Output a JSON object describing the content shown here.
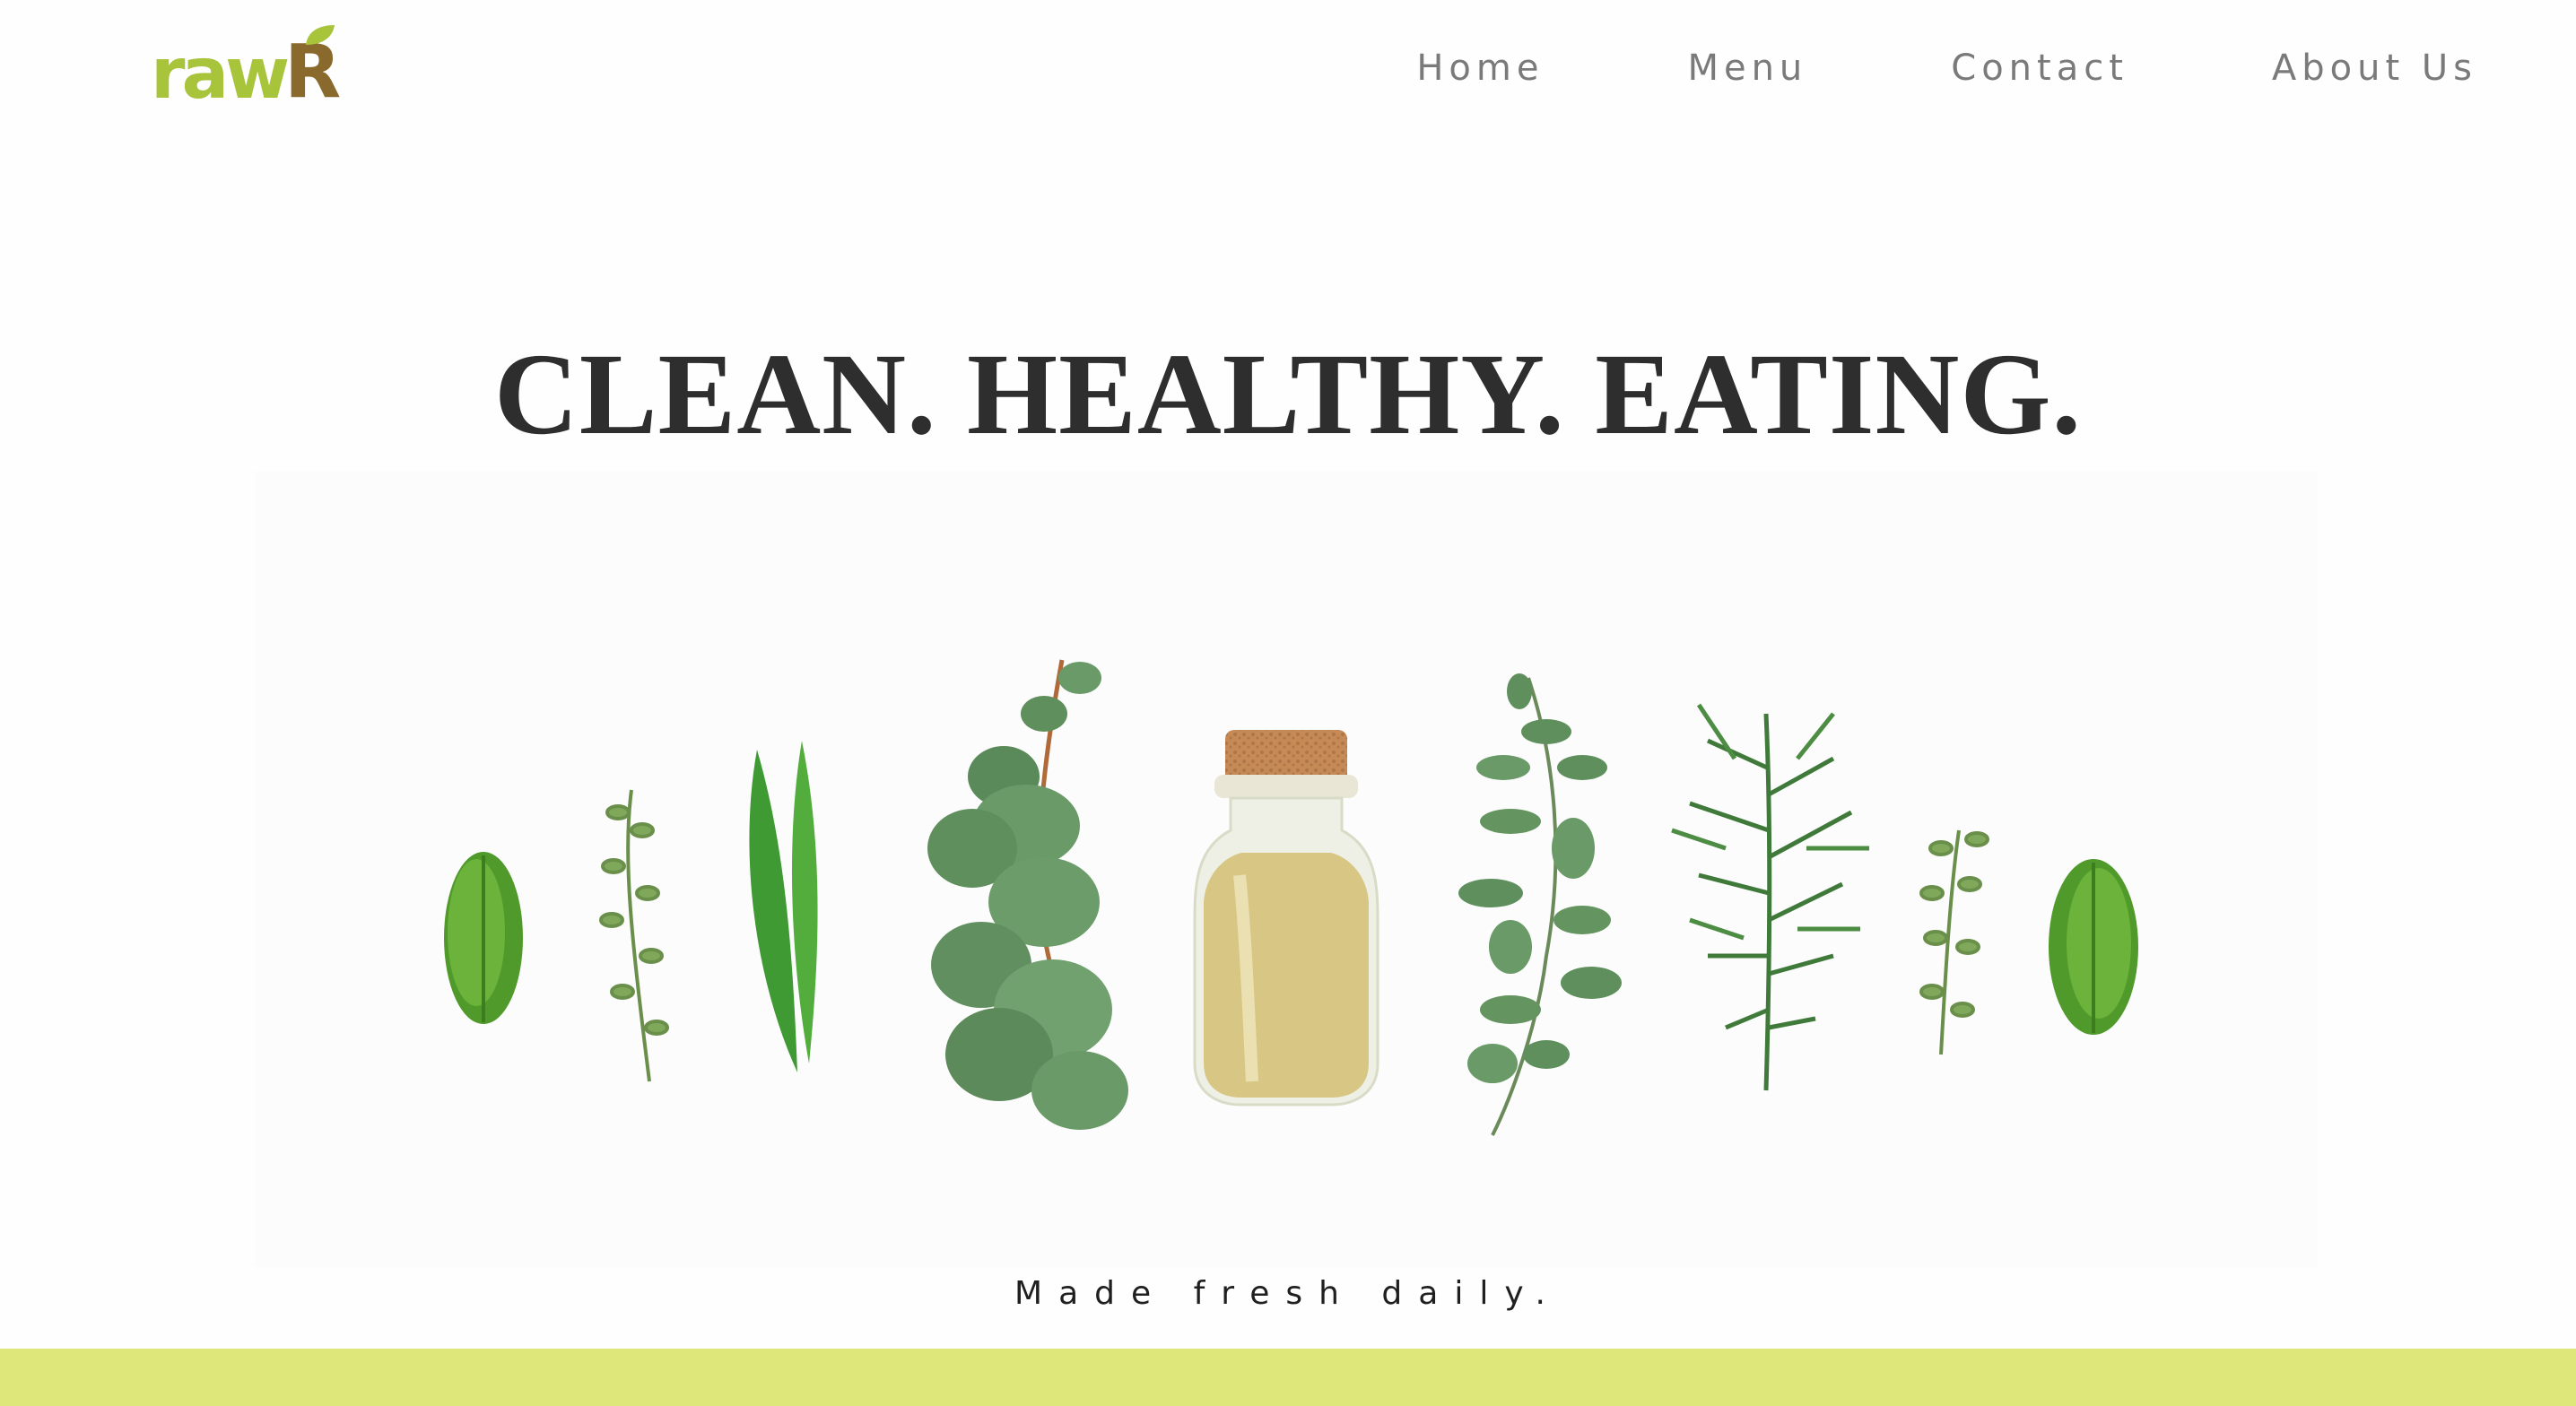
{
  "brand": {
    "logo_text_main": "raw",
    "logo_text_accent": "R",
    "logo_color_main": "#a8c43a",
    "logo_color_accent": "#8a6a2c"
  },
  "nav": {
    "items": [
      {
        "label": "Home"
      },
      {
        "label": "Menu"
      },
      {
        "label": "Contact"
      },
      {
        "label": "About Us"
      }
    ]
  },
  "hero": {
    "headline": "CLEAN. HEALTHY. EATING.",
    "image_icon": "herbs-and-oil-bottle-photo",
    "tagline": "Made fresh daily."
  },
  "colors": {
    "accent_band": "#dde77a",
    "headline": "#2e2e2e",
    "nav_text": "#7a7a7a"
  }
}
